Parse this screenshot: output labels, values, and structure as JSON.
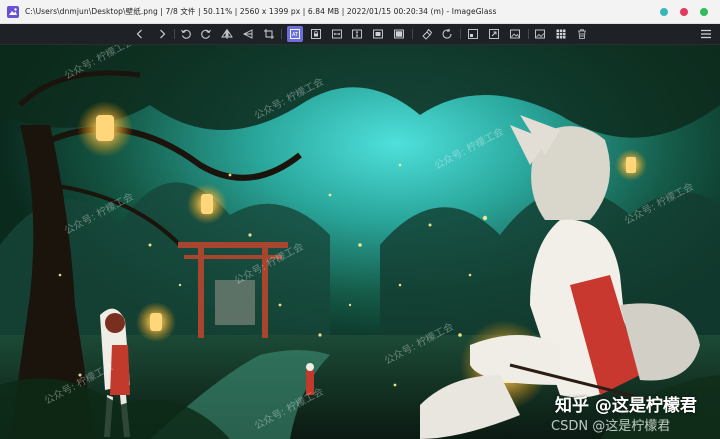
{
  "window": {
    "title": "C:\\Users\\dnmjun\\Desktop\\壁纸.png  |  7/8 文件  |  50.11%  |  2560 x 1399 px  |  6.84 MB  |  2022/01/15 00:20:34 (m)  - ImageGlass",
    "dot_colors": [
      "#3bb6b8",
      "#e23a5d",
      "#2dbb5c"
    ]
  },
  "toolbar": {
    "icons": [
      "prev-image-icon",
      "next-image-icon",
      "rotate-left-icon",
      "rotate-right-icon",
      "flip-horizontal-icon",
      "flip-vertical-icon",
      "crop-icon",
      "auto-zoom-icon",
      "lock-zoom-icon",
      "scale-to-width-icon",
      "scale-to-height-icon",
      "scale-to-fit-icon",
      "scale-to-fill-icon",
      "color-picker-icon",
      "refresh-icon",
      "fullscreen-icon",
      "slideshow-icon",
      "open-gallery-icon",
      "thumbnail-bar-icon",
      "delete-icon"
    ],
    "active_icon": "auto-zoom-icon",
    "accent": "#6b6fd9"
  },
  "image": {
    "watermark_main": "知乎 @这是柠檬君",
    "watermark_sub": "CSDN @这是柠檬君",
    "watermark_tile": "公众号: 柠檬工会"
  }
}
